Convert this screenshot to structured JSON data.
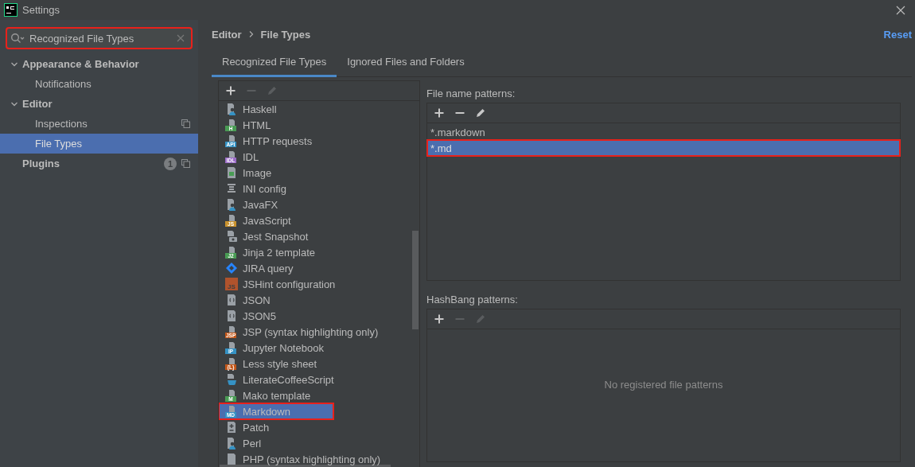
{
  "window": {
    "title": "Settings"
  },
  "search": {
    "value": "Recognized File Types",
    "highlighted": true
  },
  "sidebar": {
    "items": [
      {
        "label": "Appearance & Behavior",
        "expanded": true,
        "selected": false,
        "children": [
          {
            "label": "Notifications",
            "selected": false
          }
        ]
      },
      {
        "label": "Editor",
        "expanded": true,
        "selected": false,
        "children": [
          {
            "label": "Inspections",
            "selected": false,
            "copy_icon": true
          },
          {
            "label": "File Types",
            "selected": true
          }
        ]
      },
      {
        "label": "Plugins",
        "selected": false,
        "badge": "1",
        "copy_icon": true
      }
    ]
  },
  "breadcrumb": [
    "Editor",
    "File Types"
  ],
  "reset": "Reset",
  "tabs": [
    {
      "label": "Recognized File Types",
      "selected": true
    },
    {
      "label": "Ignored Files and Folders",
      "selected": false
    }
  ],
  "file_types": {
    "toolbar": [
      {
        "kind": "add",
        "disabled": false
      },
      {
        "kind": "remove",
        "disabled": true
      },
      {
        "kind": "edit",
        "disabled": true
      }
    ],
    "items": [
      {
        "label": "Haskell",
        "kind": "person",
        "selected": false,
        "highlighted": false
      },
      {
        "label": "HTML",
        "kind": "badge",
        "badge": "H",
        "color": "#499c54",
        "selected": false,
        "highlighted": false
      },
      {
        "label": "HTTP requests",
        "kind": "badge",
        "badge": "API",
        "color": "#3592c4",
        "selected": false,
        "highlighted": false
      },
      {
        "label": "IDL",
        "kind": "badge",
        "badge": "IDL",
        "color": "#9b6cc8",
        "selected": false,
        "highlighted": false
      },
      {
        "label": "Image",
        "kind": "image",
        "selected": false,
        "highlighted": false
      },
      {
        "label": "INI config",
        "kind": "lines",
        "selected": false,
        "highlighted": false
      },
      {
        "label": "JavaFX",
        "kind": "person",
        "selected": false,
        "highlighted": false
      },
      {
        "label": "JavaScript",
        "kind": "badge",
        "badge": "JS",
        "color": "#c9922e",
        "selected": false,
        "highlighted": false
      },
      {
        "label": "Jest Snapshot",
        "kind": "camera",
        "selected": false,
        "highlighted": false
      },
      {
        "label": "Jinja 2 template",
        "kind": "badge",
        "badge": "J2",
        "color": "#499c54",
        "selected": false,
        "highlighted": false
      },
      {
        "label": "JIRA query",
        "kind": "diamond",
        "selected": false,
        "highlighted": false
      },
      {
        "label": "JSHint configuration",
        "kind": "block",
        "badge": "JS",
        "color": "#b0532c",
        "selected": false,
        "highlighted": false
      },
      {
        "label": "JSON",
        "kind": "braces",
        "selected": false,
        "highlighted": false
      },
      {
        "label": "JSON5",
        "kind": "braces",
        "selected": false,
        "highlighted": false
      },
      {
        "label": "JSP (syntax highlighting only)",
        "kind": "badge",
        "badge": "JSP",
        "color": "#c2571a",
        "selected": false,
        "highlighted": false
      },
      {
        "label": "Jupyter Notebook",
        "kind": "badge",
        "badge": "IP",
        "color": "#3592c4",
        "selected": false,
        "highlighted": false
      },
      {
        "label": "Less style sheet",
        "kind": "badge",
        "badge": "{L}",
        "color": "#c2571a",
        "selected": false,
        "highlighted": false
      },
      {
        "label": "LiterateCoffeeScript",
        "kind": "cup",
        "selected": false,
        "highlighted": false
      },
      {
        "label": "Mako template",
        "kind": "badge",
        "badge": "M",
        "color": "#499c54",
        "selected": false,
        "highlighted": false
      },
      {
        "label": "Markdown",
        "kind": "badge",
        "badge": "MD",
        "color": "#3592c4",
        "selected": true,
        "highlighted": true
      },
      {
        "label": "Patch",
        "kind": "plusminus",
        "selected": false,
        "highlighted": false
      },
      {
        "label": "Perl",
        "kind": "person",
        "selected": false,
        "highlighted": false
      },
      {
        "label": "PHP (syntax highlighting only)",
        "kind": "page",
        "selected": false,
        "highlighted": false
      }
    ]
  },
  "file_name_patterns": {
    "label": "File name patterns:",
    "toolbar": [
      {
        "kind": "add",
        "disabled": false
      },
      {
        "kind": "remove",
        "disabled": false
      },
      {
        "kind": "edit",
        "disabled": false
      }
    ],
    "items": [
      {
        "label": "*.markdown",
        "selected": false,
        "highlighted": false
      },
      {
        "label": "*.md",
        "selected": true,
        "highlighted": true
      }
    ]
  },
  "hashbang_patterns": {
    "label": "HashBang patterns:",
    "toolbar": [
      {
        "kind": "add",
        "disabled": false
      },
      {
        "kind": "remove",
        "disabled": true
      },
      {
        "kind": "edit",
        "disabled": true
      }
    ],
    "empty_text": "No registered file patterns"
  }
}
